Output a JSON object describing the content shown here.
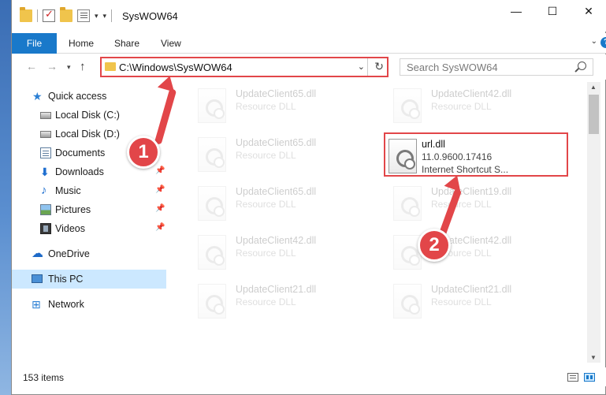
{
  "window": {
    "title": "SysWOW64",
    "controls": {
      "minimize": "—",
      "maximize": "☐",
      "close": "✕"
    }
  },
  "ribbon": {
    "tabs": [
      "File",
      "Home",
      "Share",
      "View"
    ]
  },
  "navigation": {
    "address": "C:\\Windows\\SysWOW64",
    "search_placeholder": "Search SysWOW64"
  },
  "sidebar": {
    "items": [
      {
        "label": "Quick access",
        "icon": "star-icon",
        "pinned": false
      },
      {
        "label": "Local Disk (C:)",
        "icon": "drive-icon",
        "pinned": false
      },
      {
        "label": "Local Disk (D:)",
        "icon": "drive-icon",
        "pinned": false
      },
      {
        "label": "Documents",
        "icon": "documents-icon",
        "pinned": false
      },
      {
        "label": "Downloads",
        "icon": "download-icon",
        "pinned": true
      },
      {
        "label": "Music",
        "icon": "music-icon",
        "pinned": true
      },
      {
        "label": "Pictures",
        "icon": "pictures-icon",
        "pinned": true
      },
      {
        "label": "Videos",
        "icon": "videos-icon",
        "pinned": true
      },
      {
        "label": "OneDrive",
        "icon": "cloud-icon",
        "pinned": false
      },
      {
        "label": "This PC",
        "icon": "computer-icon",
        "pinned": false,
        "selected": true
      },
      {
        "label": "Network",
        "icon": "network-icon",
        "pinned": false
      }
    ]
  },
  "files": {
    "left_column": [
      {
        "name": "UpdateClient65.dll",
        "type": "Resource DLL"
      },
      {
        "name": "UpdateClient65.dll",
        "type": "Resource DLL"
      },
      {
        "name": "UpdateClient65.dll",
        "type": "Resource DLL"
      },
      {
        "name": "UpdateClient42.dll",
        "type": "Resource DLL"
      },
      {
        "name": "UpdateClient21.dll",
        "type": "Resource DLL"
      }
    ],
    "right_column": [
      {
        "name": "UpdateClient42.dll",
        "type": "Resource DLL"
      },
      {
        "name": "url.dll",
        "version": "11.0.9600.17416",
        "type": "Internet Shortcut S...",
        "highlighted": true
      },
      {
        "name": "UpdateClient19.dll",
        "type": "Resource DLL"
      },
      {
        "name": "UpdateClient42.dll",
        "type": "Resource DLL"
      },
      {
        "name": "UpdateClient21.dll",
        "type": "Resource DLL"
      }
    ]
  },
  "status": {
    "item_count": "153 items"
  },
  "annotations": {
    "step1": "1",
    "step2": "2",
    "color": "#e24649"
  }
}
